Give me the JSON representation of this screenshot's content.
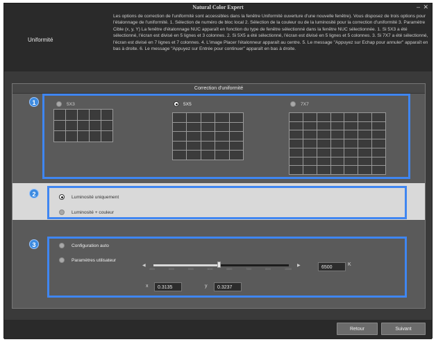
{
  "app": {
    "title": "Natural Color Expert"
  },
  "header": {
    "title": "Uniformité",
    "description": "Les options de correction de l'uniformité sont accessibles dans la fenêtre Uniformité ouverture d'une nouvelle fenêtre). Vous disposez de trois options pour l'étalonnage de l'uniformité. 1. Sélection de numéro de bloc local 2. Sélection de la couleur ou de la luminosité pour la correction d'uniformité 3. Paramètre Cible (x, y, Y) La fenêtre d'étalonnage NUC apparaît en fonction du type de fenêtre sélectionné dans la fenêtre NUC sélectionnée. 1. Si 5X3 a été sélectionné, l'écran est divisé en 5 lignes et 3 colonnes. 2. Si 5X5 a été sélectionné, l'écran est divisé en 5 lignes et 5 colonnes. 3. Si 7X7 a été sélectionné, l'écran est divisé en 7 lignes et 7 colonnes. 4. L'image Placer l'étalonneur apparaît au centre. 5. Le message \"Appuyez sur Echap pour annuler\" apparaît en bas à droite. 6. Le message \"Appuyez sur Entrée pour continuer\" apparaît en bas à droite."
  },
  "panel": {
    "title": "Correction d'uniformité"
  },
  "section1": {
    "badge": "1",
    "options": [
      {
        "label": "5X3",
        "selected": false,
        "rows": 5,
        "cols": 3
      },
      {
        "label": "5X5",
        "selected": true,
        "rows": 5,
        "cols": 5
      },
      {
        "label": "7X7",
        "selected": false,
        "rows": 7,
        "cols": 7
      }
    ]
  },
  "section2": {
    "badge": "2",
    "options": [
      {
        "label": "Luminosité uniquement",
        "selected": true
      },
      {
        "label": "Luminosité + couleur",
        "selected": false
      }
    ]
  },
  "section3": {
    "badge": "3",
    "options": [
      {
        "label": "Configuration auto",
        "selected": false
      },
      {
        "label": "Paramètres utilisateur",
        "selected": false
      }
    ],
    "slider": {
      "value_fraction": 0.48,
      "ticks": [
        "4500",
        "5000",
        "5500",
        "6000",
        "6500",
        "7000",
        "8000",
        "10000"
      ]
    },
    "kelvin_value": "6500",
    "kelvin_unit": "K",
    "x_label": "x",
    "x_value": "0.3135",
    "y_label": "y",
    "y_value": "0.3237"
  },
  "footer": {
    "back": "Retour",
    "next": "Suivant"
  },
  "colors": {
    "accent": "#3f86f1",
    "badge": "#3d8be0"
  }
}
